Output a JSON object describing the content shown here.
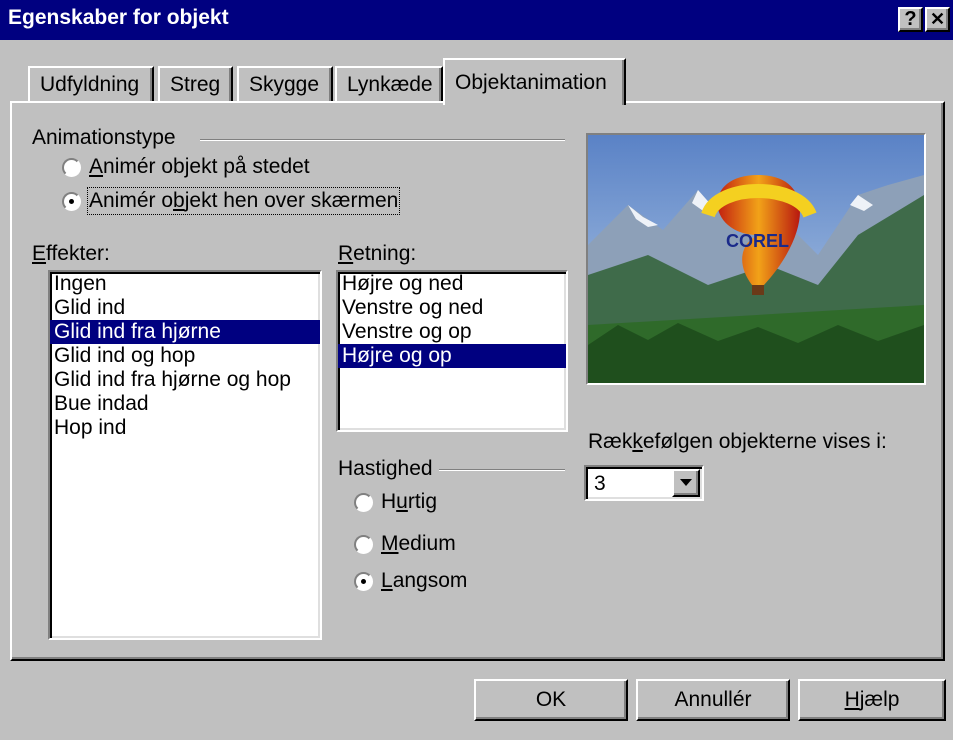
{
  "window": {
    "title": "Egenskaber for objekt",
    "help_glyph": "?",
    "close_glyph": "✕"
  },
  "tabs": [
    {
      "label": "Udfyldning"
    },
    {
      "label": "Streg"
    },
    {
      "label": "Skygge"
    },
    {
      "label": "Lynkæde"
    },
    {
      "label": "Objektanimation",
      "active": true
    }
  ],
  "animation_type": {
    "title": "Animationstype",
    "options": [
      {
        "pre": "",
        "key": "A",
        "post": "nimér objekt på stedet",
        "checked": false
      },
      {
        "pre": "Animér o",
        "key": "b",
        "post": "jekt hen over skærmen",
        "checked": true
      }
    ]
  },
  "effects": {
    "label_key": "E",
    "label_rest": "ffekter:",
    "items": [
      "Ingen",
      "Glid ind",
      "Glid ind fra hjørne",
      "Glid ind og hop",
      "Glid ind fra hjørne og hop",
      "Bue indad",
      "Hop ind"
    ],
    "selected": "Glid ind fra hjørne"
  },
  "direction": {
    "label_key": "R",
    "label_rest": "etning:",
    "items": [
      "Højre og ned",
      "Venstre og ned",
      "Venstre og op",
      "Højre og op"
    ],
    "selected": "Højre og op"
  },
  "speed": {
    "title": "Hastighed",
    "options": [
      {
        "pre": "H",
        "key": "u",
        "post": "rtig",
        "checked": false
      },
      {
        "pre": "",
        "key": "M",
        "post": "edium",
        "checked": false
      },
      {
        "pre": "",
        "key": "L",
        "post": "angsom",
        "checked": true
      }
    ]
  },
  "order": {
    "label_pre": "Ræk",
    "label_key": "k",
    "label_post": "efølgen objekterne vises i:",
    "value": "3"
  },
  "preview": {
    "logo_text": "COREL"
  },
  "buttons": {
    "ok": "OK",
    "cancel": "Annullér",
    "help_key": "H",
    "help_rest": "jælp"
  },
  "colors": {
    "titlebar": "#000080",
    "selection": "#000080",
    "face": "#c0c0c0"
  }
}
